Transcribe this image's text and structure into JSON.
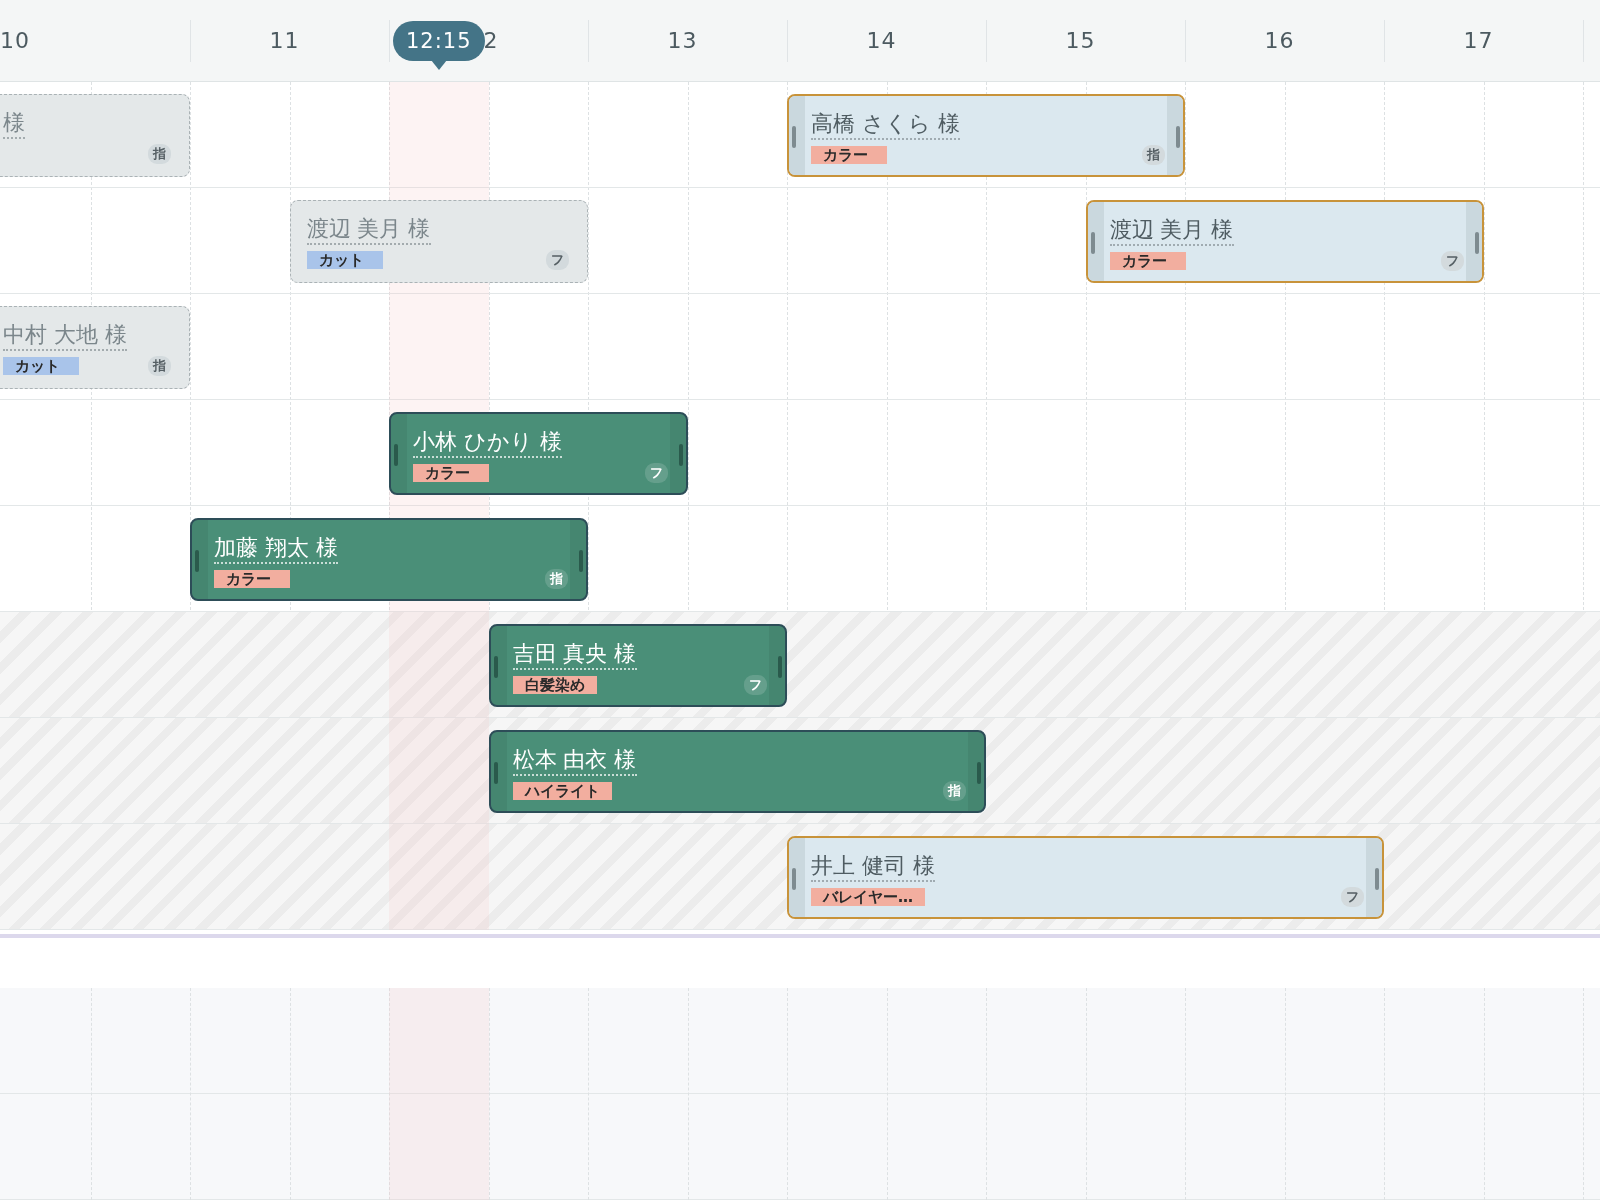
{
  "header": {
    "hours": [
      "10",
      "11",
      "2",
      "13",
      "14",
      "15",
      "16",
      "17"
    ],
    "now": {
      "label": "12:15"
    }
  },
  "rows": [
    {
      "blocked": false,
      "events": [
        {
          "kind": "pending",
          "name": "様",
          "badge": "指"
        },
        {
          "kind": "selected",
          "name": "高橋 さくら 様",
          "tag": {
            "label": "カラー",
            "color": "#f2ae9f"
          },
          "badge": "指"
        }
      ]
    },
    {
      "blocked": false,
      "events": [
        {
          "kind": "pending",
          "name": "渡辺 美月 様",
          "tag": {
            "label": "カット",
            "color": "#a9c4ea"
          },
          "badge": "フ"
        },
        {
          "kind": "selected",
          "name": "渡辺 美月 様",
          "tag": {
            "label": "カラー",
            "color": "#f2ae9f"
          },
          "badge": "フ"
        }
      ]
    },
    {
      "blocked": false,
      "events": [
        {
          "kind": "pending",
          "name": "中村 大地 様",
          "tag": {
            "label": "カット",
            "color": "#a9c4ea"
          },
          "badge": "指"
        }
      ]
    },
    {
      "blocked": false,
      "events": [
        {
          "kind": "confirmed",
          "name": "小林 ひかり 様",
          "tag": {
            "label": "カラー",
            "color": "#f2ae9f"
          },
          "badge": "フ"
        }
      ]
    },
    {
      "blocked": false,
      "events": [
        {
          "kind": "confirmed",
          "name": "加藤 翔太 様",
          "tag": {
            "label": "カラー",
            "color": "#f2ae9f"
          },
          "badge": "指"
        }
      ]
    },
    {
      "blocked": true,
      "events": [
        {
          "kind": "confirmed",
          "name": "吉田 真央 様",
          "tag": {
            "label": "白髪染め",
            "color": "#f2ae9f"
          },
          "badge": "フ"
        }
      ]
    },
    {
      "blocked": true,
      "events": [
        {
          "kind": "confirmed",
          "name": "松本 由衣 様",
          "tag": {
            "label": "ハイライト",
            "color": "#f2ae9f"
          },
          "badge": "指"
        }
      ]
    },
    {
      "blocked": true,
      "events": [
        {
          "kind": "selected",
          "name": "井上 健司 様",
          "tag": {
            "label": "バレイヤー…",
            "color": "#f2ae9f"
          },
          "badge": "フ"
        }
      ]
    }
  ]
}
